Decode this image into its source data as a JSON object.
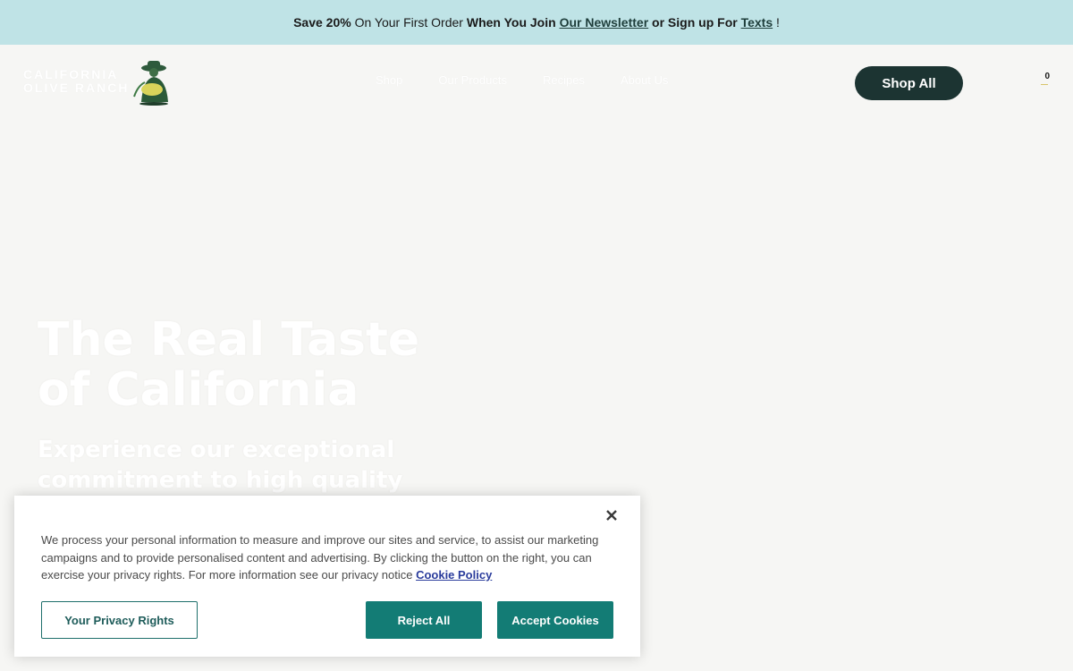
{
  "announcement": {
    "part1": "Save 20%",
    "part2": " On Your First Order ",
    "part3": "When You Join ",
    "newsletter_link": "Our Newsletter",
    "part4": " or Sign up For ",
    "texts_link": "Texts",
    "part5": " !"
  },
  "header": {
    "logo_line1": "CALIFORNIA",
    "logo_line2": "OLIVE RANCH",
    "nav": [
      "Shop",
      "Our Products",
      "Recipes",
      "About Us"
    ],
    "shop_all": "Shop All",
    "cart_count": "0"
  },
  "hero": {
    "title_line1": "The Real Taste",
    "title_line2": "of California",
    "subtitle_line1": "Experience our exceptional",
    "subtitle_line2": "commitment to high quality"
  },
  "cookie_banner": {
    "message": "We process your personal information to measure and improve our sites and service, to assist our marketing campaigns and to provide personalised content and advertising. By clicking the button on the right, you can exercise your privacy rights. For more information see our privacy notice",
    "policy_link": "Cookie Policy",
    "privacy_button": "Your Privacy Rights",
    "reject_button": "Reject All",
    "accept_button": "Accept Cookies"
  },
  "colors": {
    "announcement_bg": "#bfe3e6",
    "page_bg": "#f6f6f4",
    "shop_button": "#1c3432",
    "cookie_primary": "#137c75"
  }
}
